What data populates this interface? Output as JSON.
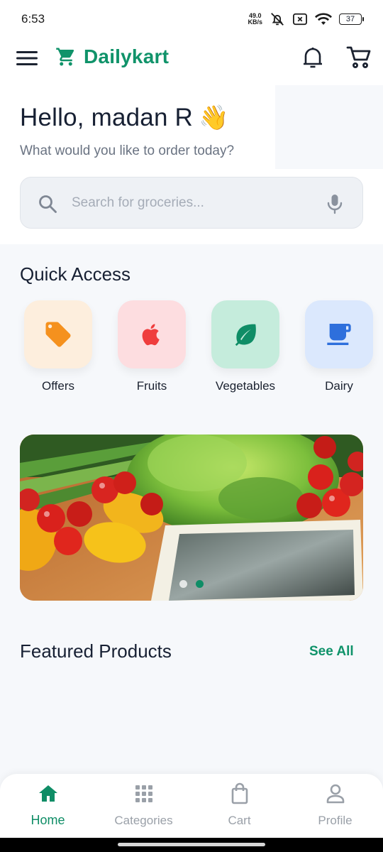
{
  "status_bar": {
    "time": "6:53",
    "net_speed_value": "49.0",
    "net_speed_unit": "KB/s",
    "battery": "37"
  },
  "app_bar": {
    "brand": "Dailykart",
    "brand_color": "#10936a"
  },
  "greeting": {
    "title": "Hello, madan R",
    "emoji": "👋",
    "subtitle": "What would you like to order today?"
  },
  "search": {
    "placeholder": "Search for groceries..."
  },
  "quick_access": {
    "title": "Quick Access",
    "items": [
      {
        "label": "Offers",
        "icon": "tag-icon",
        "bg": "#fdeedd",
        "color": "#f5911e"
      },
      {
        "label": "Fruits",
        "icon": "apple-icon",
        "bg": "#fddde0",
        "color": "#ef3d3d"
      },
      {
        "label": "Vegetables",
        "icon": "leaf-icon",
        "bg": "#c5ecdc",
        "color": "#0f8d66"
      },
      {
        "label": "Dairy",
        "icon": "cup-icon",
        "bg": "#dbe8fd",
        "color": "#2e6fdc"
      }
    ]
  },
  "banner": {
    "slides": 2,
    "active_slide": 2
  },
  "featured": {
    "title": "Featured Products",
    "see_all": "See All"
  },
  "bottom_nav": {
    "items": [
      {
        "label": "Home",
        "icon": "home-icon",
        "active": true
      },
      {
        "label": "Categories",
        "icon": "grid-icon",
        "active": false
      },
      {
        "label": "Cart",
        "icon": "shopping-bag-icon",
        "active": false
      },
      {
        "label": "Profile",
        "icon": "person-icon",
        "active": false
      }
    ],
    "active_color": "#0f8d66",
    "inactive_color": "#9aa0a8"
  }
}
